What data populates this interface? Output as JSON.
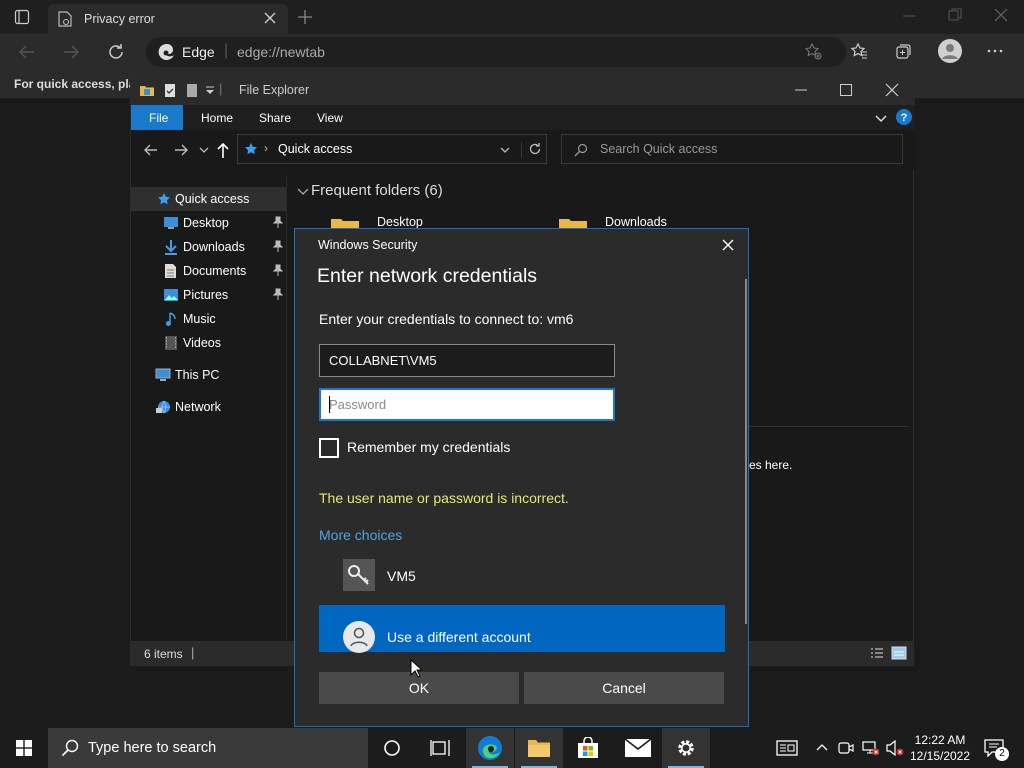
{
  "browser": {
    "tab_title": "Privacy error",
    "edge_label": "Edge",
    "url": "edge://newtab",
    "favbar_text": "For quick access, plac"
  },
  "explorer": {
    "title": "File Explorer",
    "ribbon_tabs": [
      "File",
      "Home",
      "Share",
      "View"
    ],
    "address": "Quick access",
    "search_placeholder": "Search Quick access",
    "nav": {
      "quick_access": "Quick access",
      "desktop": "Desktop",
      "downloads": "Downloads",
      "documents": "Documents",
      "pictures": "Pictures",
      "music": "Music",
      "videos": "Videos",
      "this_pc": "This PC",
      "network": "Network"
    },
    "section_title": "Frequent folders (6)",
    "folders": [
      "Desktop",
      "Downloads"
    ],
    "partial_text": "es here.",
    "status_count": "6 items"
  },
  "dialog": {
    "caption": "Windows Security",
    "heading": "Enter network credentials",
    "prompt": "Enter your credentials to connect to: vm6",
    "username_value": "COLLABNET\\VM5",
    "password_placeholder": "Password",
    "remember_label": "Remember my credentials",
    "error_text": "The user name or password is incorrect.",
    "error_color": "#e8e86a",
    "more_choices": "More choices",
    "accounts": [
      "VM5",
      "Use a different account"
    ],
    "ok_label": "OK",
    "cancel_label": "Cancel"
  },
  "taskbar": {
    "search_placeholder": "Type here to search",
    "time": "12:22 AM",
    "date": "12/15/2022",
    "notification_count": "2"
  }
}
